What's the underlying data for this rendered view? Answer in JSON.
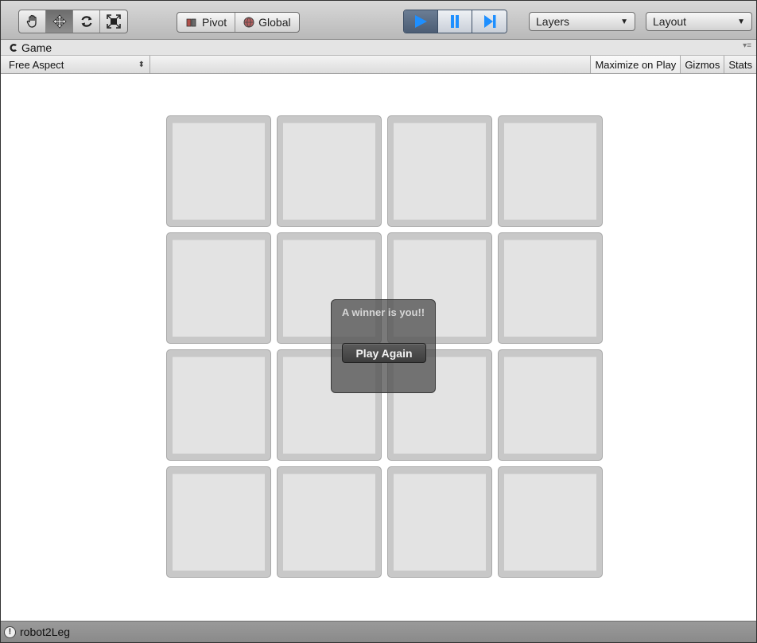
{
  "toolbar": {
    "tools": [
      {
        "icon": "hand-icon",
        "active": false
      },
      {
        "icon": "move-icon",
        "active": true
      },
      {
        "icon": "rotate-icon",
        "active": false
      },
      {
        "icon": "scale-icon",
        "active": false
      }
    ],
    "pivot_label": "Pivot",
    "global_label": "Global",
    "play_controls": [
      {
        "icon": "play-icon",
        "active": true
      },
      {
        "icon": "pause-icon",
        "active": false
      },
      {
        "icon": "step-icon",
        "active": false
      }
    ],
    "layers_label": "Layers",
    "layout_label": "Layout"
  },
  "panel": {
    "tab_title": "Game",
    "aspect_label": "Free Aspect",
    "maximize_label": "Maximize on Play",
    "gizmos_label": "Gizmos",
    "stats_label": "Stats"
  },
  "game": {
    "grid_rows": 4,
    "grid_cols": 4,
    "dialog": {
      "message": "A winner is you!!",
      "button_label": "Play Again"
    }
  },
  "status": {
    "text": "robot2Leg"
  },
  "colors": {
    "play_active": "#1e8fff",
    "tile_face": "#e3e3e3",
    "tile_border": "#c8c8c8"
  }
}
